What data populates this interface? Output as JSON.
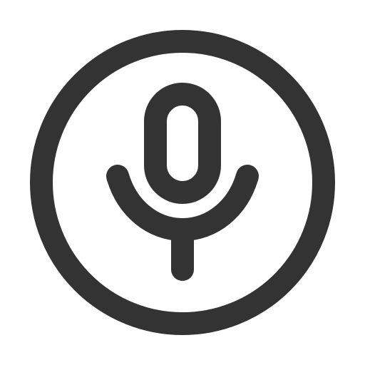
{
  "icon": {
    "name": "microphone-in-circle-icon",
    "stroke_color": "#333333",
    "background_color": "#ffffff"
  }
}
